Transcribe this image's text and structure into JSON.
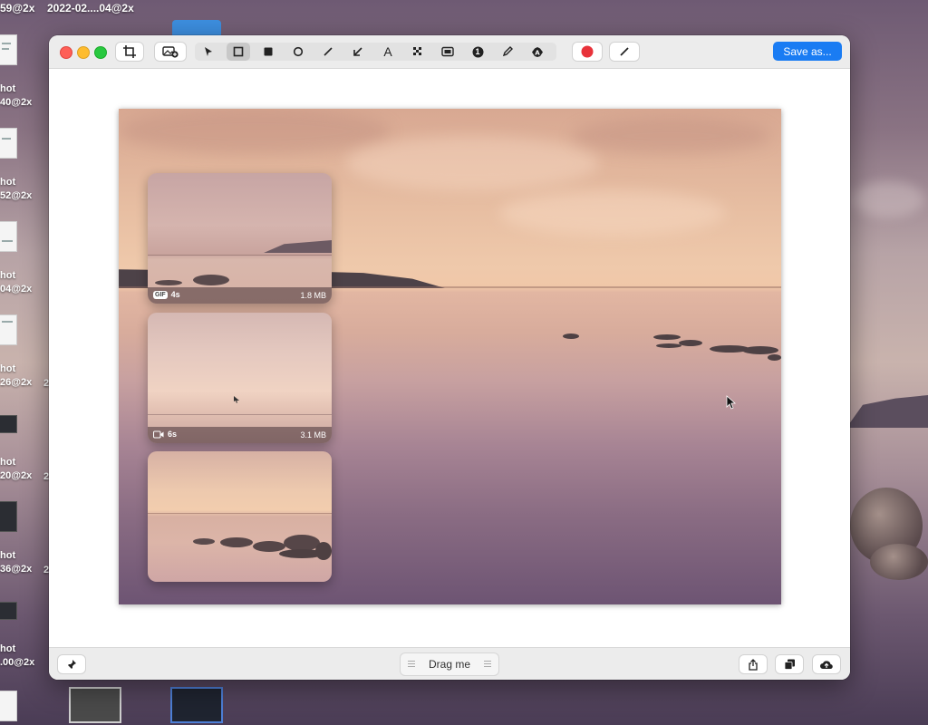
{
  "desktop": {
    "top_labels": [
      "59@2x",
      "2022-02....04@2x"
    ],
    "file_labels": [
      {
        "l1": "hot",
        "l2": "40@2x"
      },
      {
        "l1": "hot",
        "l2": "52@2x"
      },
      {
        "l1": "hot",
        "l2": "04@2x"
      },
      {
        "l1": "hot",
        "l2": "26@2x"
      },
      {
        "l1": "hot",
        "l2": "20@2x"
      },
      {
        "l1": "hot",
        "l2": "36@2x"
      },
      {
        "l1": "hot",
        "l2": ".00@2x"
      }
    ],
    "side_numbers": [
      "2",
      "2",
      "2"
    ]
  },
  "window": {
    "toolbar": {
      "tools": [
        "select-arrow",
        "rectangle-outline",
        "rectangle-filled",
        "ellipse",
        "line",
        "arrow",
        "text",
        "pixelate",
        "highlight",
        "counter",
        "pencil",
        "blur"
      ],
      "active_tool": "rectangle-outline",
      "counter_glyph": "1",
      "text_glyph": "A",
      "color": "#e8323a",
      "save_label": "Save as..."
    },
    "recordings": [
      {
        "format": "GIF",
        "duration": "4s",
        "size": "1.8 MB"
      },
      {
        "format": "video",
        "duration": "6s",
        "size": "3.1 MB"
      },
      {
        "format": "image",
        "duration": "",
        "size": ""
      }
    ],
    "bottom": {
      "drag_label": "Drag me"
    }
  }
}
